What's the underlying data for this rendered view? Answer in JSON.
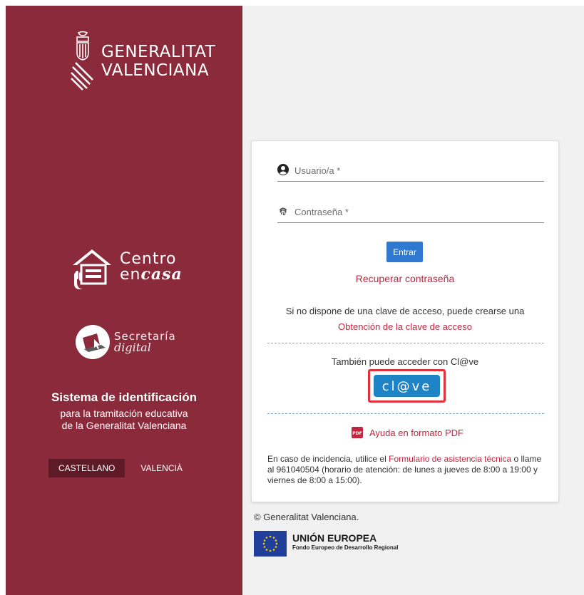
{
  "brand": {
    "org_line1": "GENERALITAT",
    "org_line2": "VALENCIANA",
    "centro_line1": "Centro",
    "centro_line2_prefix": "en",
    "centro_line2_bold": "casa",
    "secretaria_line1": "Secretaría",
    "secretaria_line2": "digital"
  },
  "system": {
    "title": "Sistema de identificación",
    "subtitle_line1": "para la tramitación educativa",
    "subtitle_line2": "de la Generalitat Valenciana"
  },
  "language": {
    "active": "CASTELLANO",
    "other": "VALENCIÀ"
  },
  "login": {
    "user_placeholder": "Usuario/a *",
    "password_placeholder": "Contraseña *",
    "submit_label": "Entrar",
    "recover_link": "Recuperar contraseña",
    "no_key_text": "Si no dispone de una clave de acceso, puede crearse una",
    "obtain_link": "Obtención de la clave de acceso",
    "clave_text": "También puede acceder con Cl@ve",
    "clave_button_label": "cl@ve",
    "pdf_link": "Ayuda en formato PDF",
    "incident_prefix": "En caso de incidencia, utilice el ",
    "incident_link": "Formulario de asistencia técnica",
    "incident_suffix": " o llame al 961040504 (horario de atención: de lunes a jueves de 8:00 a 19:00 y viernes de 8:00 a 15:00)."
  },
  "footer": {
    "copyright": "© Generalitat Valenciana.",
    "eu_title": "UNIÓN EUROPEA",
    "eu_subtitle": "Fondo Europeo de Desarrollo Regional"
  },
  "icons": {
    "gv_logo": "generalitat-crest-icon",
    "centro": "house-hand-icon",
    "secretaria": "laptop-cursor-icon",
    "user": "user-circle-icon",
    "password": "fingerprint-icon",
    "pdf": "pdf-icon",
    "eu_flag": "eu-flag-icon"
  },
  "colors": {
    "sidebar": "#8b2a3a",
    "sidebar_active": "#5e1a26",
    "link": "#c0263f",
    "primary": "#2f7ad0",
    "clave": "#1f84c6",
    "highlight": "#e0313c"
  }
}
